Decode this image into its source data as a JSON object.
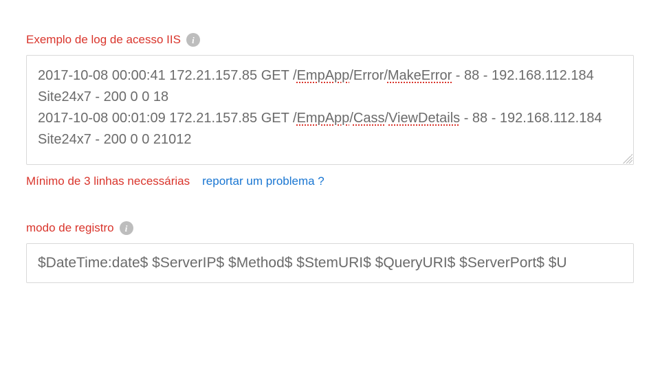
{
  "section1": {
    "label": "Exemplo de log de acesso IIS",
    "info_icon": "i",
    "log_line1_a": "2017-10-08 00:00:41 172.21.157.85 GET /",
    "log_line1_b": "EmpApp",
    "log_line1_c": "/Error/",
    "log_line1_d": "MakeError",
    "log_line1_e": " - 88 - 192.168.112.184 Site24x7 - 200 0 0 18",
    "log_line2_a": "2017-10-08 00:01:09 172.21.157.85 GET /",
    "log_line2_b": "EmpApp",
    "log_line2_c": "/",
    "log_line2_d": "Cass",
    "log_line2_e": "/",
    "log_line2_f": "ViewDetails",
    "log_line2_g": " - 88 - 192.168.112.184 Site24x7 - 200 0 0 21012",
    "hint_error": "Mínimo de 3 linhas necessárias",
    "hint_link": "reportar um problema ?"
  },
  "section2": {
    "label": "modo de registro",
    "info_icon": "i",
    "pattern_value": "$DateTime:date$ $ServerIP$ $Method$ $StemURI$ $QueryURI$ $ServerPort$ $U"
  }
}
